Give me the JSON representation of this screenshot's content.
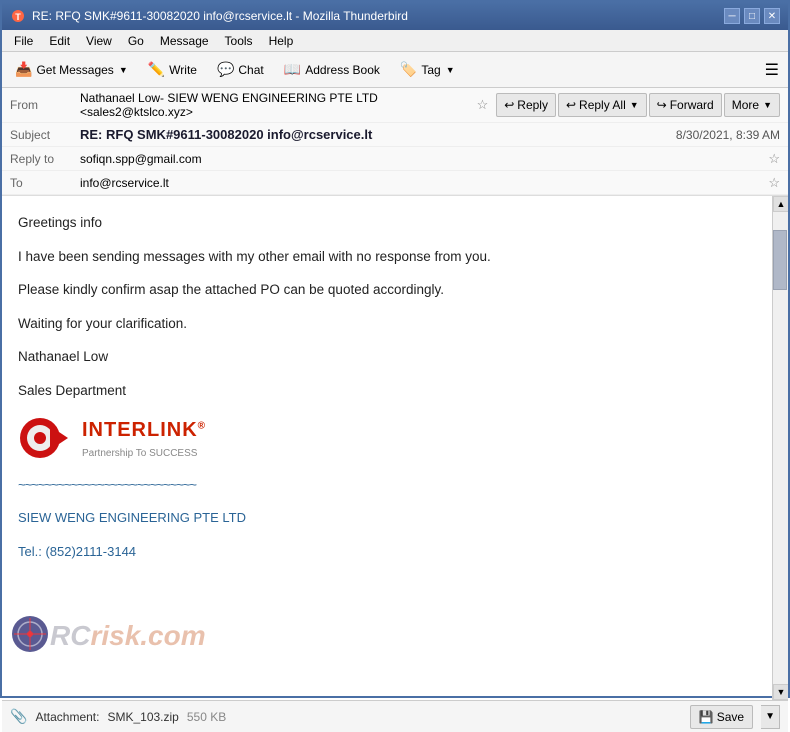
{
  "window": {
    "title": "RE: RFQ SMK#9611-30082020 info@rcservice.lt - Mozilla Thunderbird",
    "icon": "🔴"
  },
  "titlebar": {
    "minimize": "─",
    "maximize": "□",
    "close": "✕"
  },
  "menubar": {
    "items": [
      "File",
      "Edit",
      "View",
      "Go",
      "Message",
      "Tools",
      "Help"
    ]
  },
  "toolbar": {
    "get_messages_label": "Get Messages",
    "write_label": "Write",
    "chat_label": "Chat",
    "address_book_label": "Address Book",
    "tag_label": "Tag",
    "menu_icon": "☰"
  },
  "email_header": {
    "from_label": "From",
    "from_value": "Nathanael Low- SIEW WENG ENGINEERING PTE LTD <sales2@ktslco.xyz>",
    "reply_label": "Reply",
    "reply_all_label": "Reply All",
    "forward_label": "Forward",
    "more_label": "More",
    "subject_label": "Subject",
    "subject_value": "RE: RFQ SMK#9611-30082020 info@rcservice.lt",
    "date_value": "8/30/2021, 8:39 AM",
    "reply_to_label": "Reply to",
    "reply_to_value": "sofiqn.spp@gmail.com",
    "to_label": "To",
    "to_value": "info@rcservice.lt"
  },
  "email_body": {
    "greeting": "Greetings info",
    "paragraph1": "I have been sending messages with my other email with no response from you.",
    "paragraph2": "Please kindly confirm asap the attached PO can be quoted accordingly.",
    "paragraph3": "Waiting for your clarification.",
    "signature_name": "Nathanael Low",
    "signature_dept": "Sales Department",
    "tilde_line": "~~~~~~~~~~~~~~~~~~~~~~~~~~~",
    "company_name": "SIEW WENG ENGINEERING PTE LTD",
    "tel": "Tel.: (852)2111-3144",
    "logo_brand": "INTERLINK",
    "logo_reg": "®",
    "logo_tagline": "Partnership To SUCCESS"
  },
  "attachment": {
    "label": "Attachment:",
    "filename": "SMK_103.zip",
    "size": "550 KB",
    "save_label": "Save"
  },
  "watermark": {
    "part1": "RC",
    "part2": "risk",
    "part3": ".com"
  }
}
